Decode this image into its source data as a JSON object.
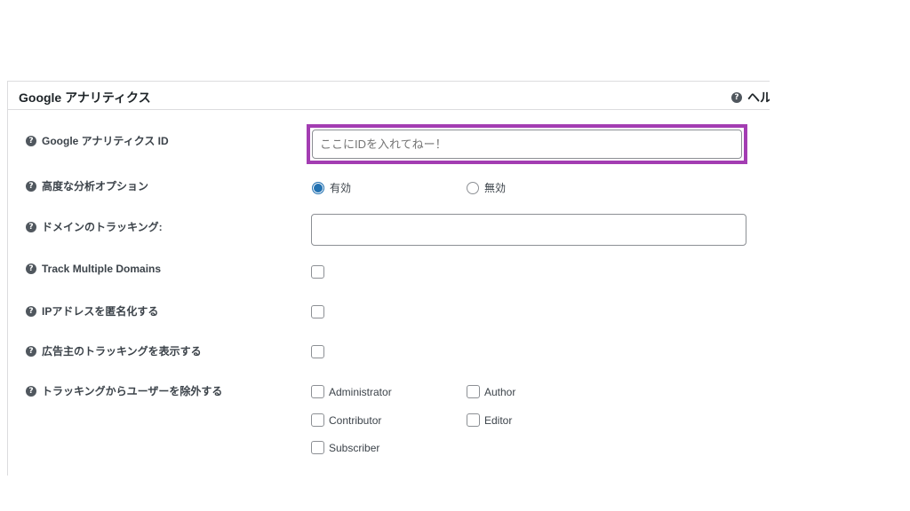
{
  "panel": {
    "title": "Google アナリティクス",
    "help_label": "ヘル",
    "help_icon": "question-circle-icon"
  },
  "fields": {
    "ga_id": {
      "label": "Google アナリティクス ID",
      "placeholder": "ここにIDを入れてねー！",
      "value": ""
    },
    "advanced": {
      "label": "高度な分析オプション",
      "options": [
        {
          "label": "有効",
          "selected": true
        },
        {
          "label": "無効",
          "selected": false
        }
      ]
    },
    "domain_tracking": {
      "label": "ドメインのトラッキング:",
      "value": ""
    },
    "multi_domains": {
      "label": "Track Multiple Domains",
      "checked": false
    },
    "anonymize_ip": {
      "label": "IPアドレスを匿名化する",
      "checked": false
    },
    "advertiser": {
      "label": "広告主のトラッキングを表示する",
      "checked": false
    },
    "exclude_roles": {
      "label": "トラッキングからユーザーを除外する",
      "roles": [
        {
          "label": "Administrator",
          "checked": false
        },
        {
          "label": "Author",
          "checked": false
        },
        {
          "label": "Contributor",
          "checked": false
        },
        {
          "label": "Editor",
          "checked": false
        },
        {
          "label": "Subscriber",
          "checked": false
        }
      ]
    }
  },
  "colors": {
    "highlight_border": "#a33db2",
    "radio_selected": "#2271b1"
  }
}
